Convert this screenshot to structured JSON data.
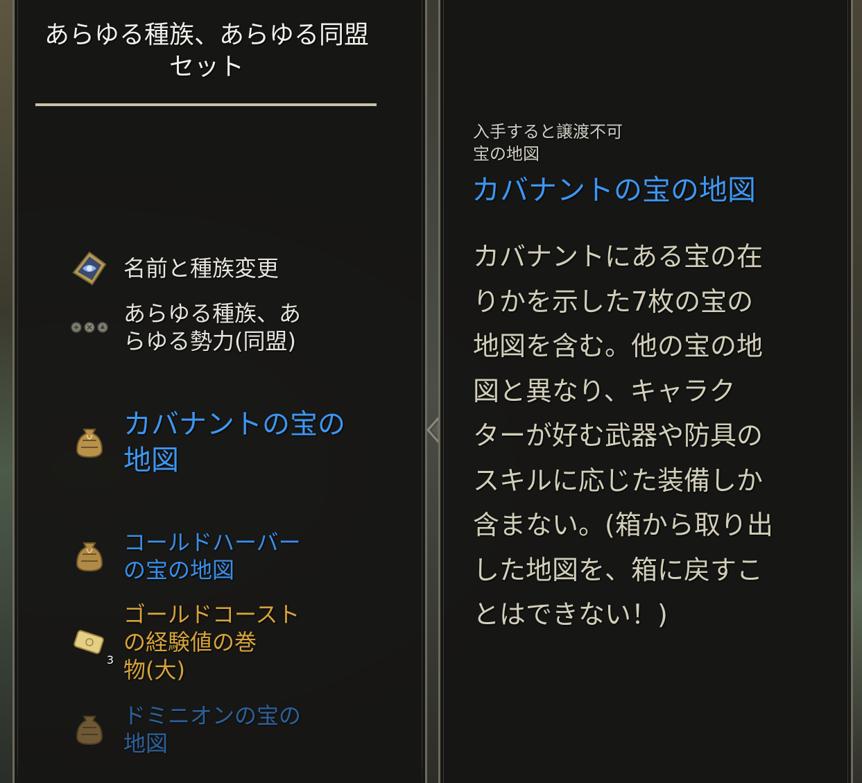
{
  "left_panel": {
    "title": "あらゆる種族、あらゆる同盟\nセット",
    "items": [
      {
        "label": "名前と種族変更",
        "icon": "name-race-change-token-icon",
        "color": "#e6e4dc"
      },
      {
        "label": "あらゆる種族、あ\nらゆる勢力(同盟)",
        "icon": "alliance-emblems-icon",
        "color": "#e6e4dc"
      },
      {
        "label": "カバナントの宝の\n地図",
        "icon": "treasure-map-bag-icon",
        "color": "#3e96f0"
      },
      {
        "label": "コールドハーバー\nの宝の地図",
        "icon": "treasure-map-bag-icon",
        "color": "#3a8ee8"
      },
      {
        "label": "ゴールドコースト\nの経験値の巻\n物(大)",
        "icon": "experience-scroll-icon",
        "color": "#d6a33b",
        "quantity": "3"
      },
      {
        "label": "ドミニオンの宝の\n地図",
        "icon": "treasure-map-bag-icon",
        "color": "#3a8ee8"
      }
    ]
  },
  "right_panel": {
    "meta": "入手すると譲渡不可\n宝の地図",
    "item_name": "カバナントの宝の地図",
    "description": "カバナントにある宝の在\nりかを示した7枚の宝の\n地図を含む。他の宝の地\n図と異なり、キャラク\nターが好む武器や防具の\nスキルに応じた装備しか\n含まない。(箱から取り出\nした地図を、箱に戻すこ\nとはできない！)"
  },
  "colors": {
    "blue_quality": "#3e96f0",
    "gold_quality": "#d6a33b",
    "divider": "#c9c3a4",
    "description_text": "#d2cfb9"
  }
}
